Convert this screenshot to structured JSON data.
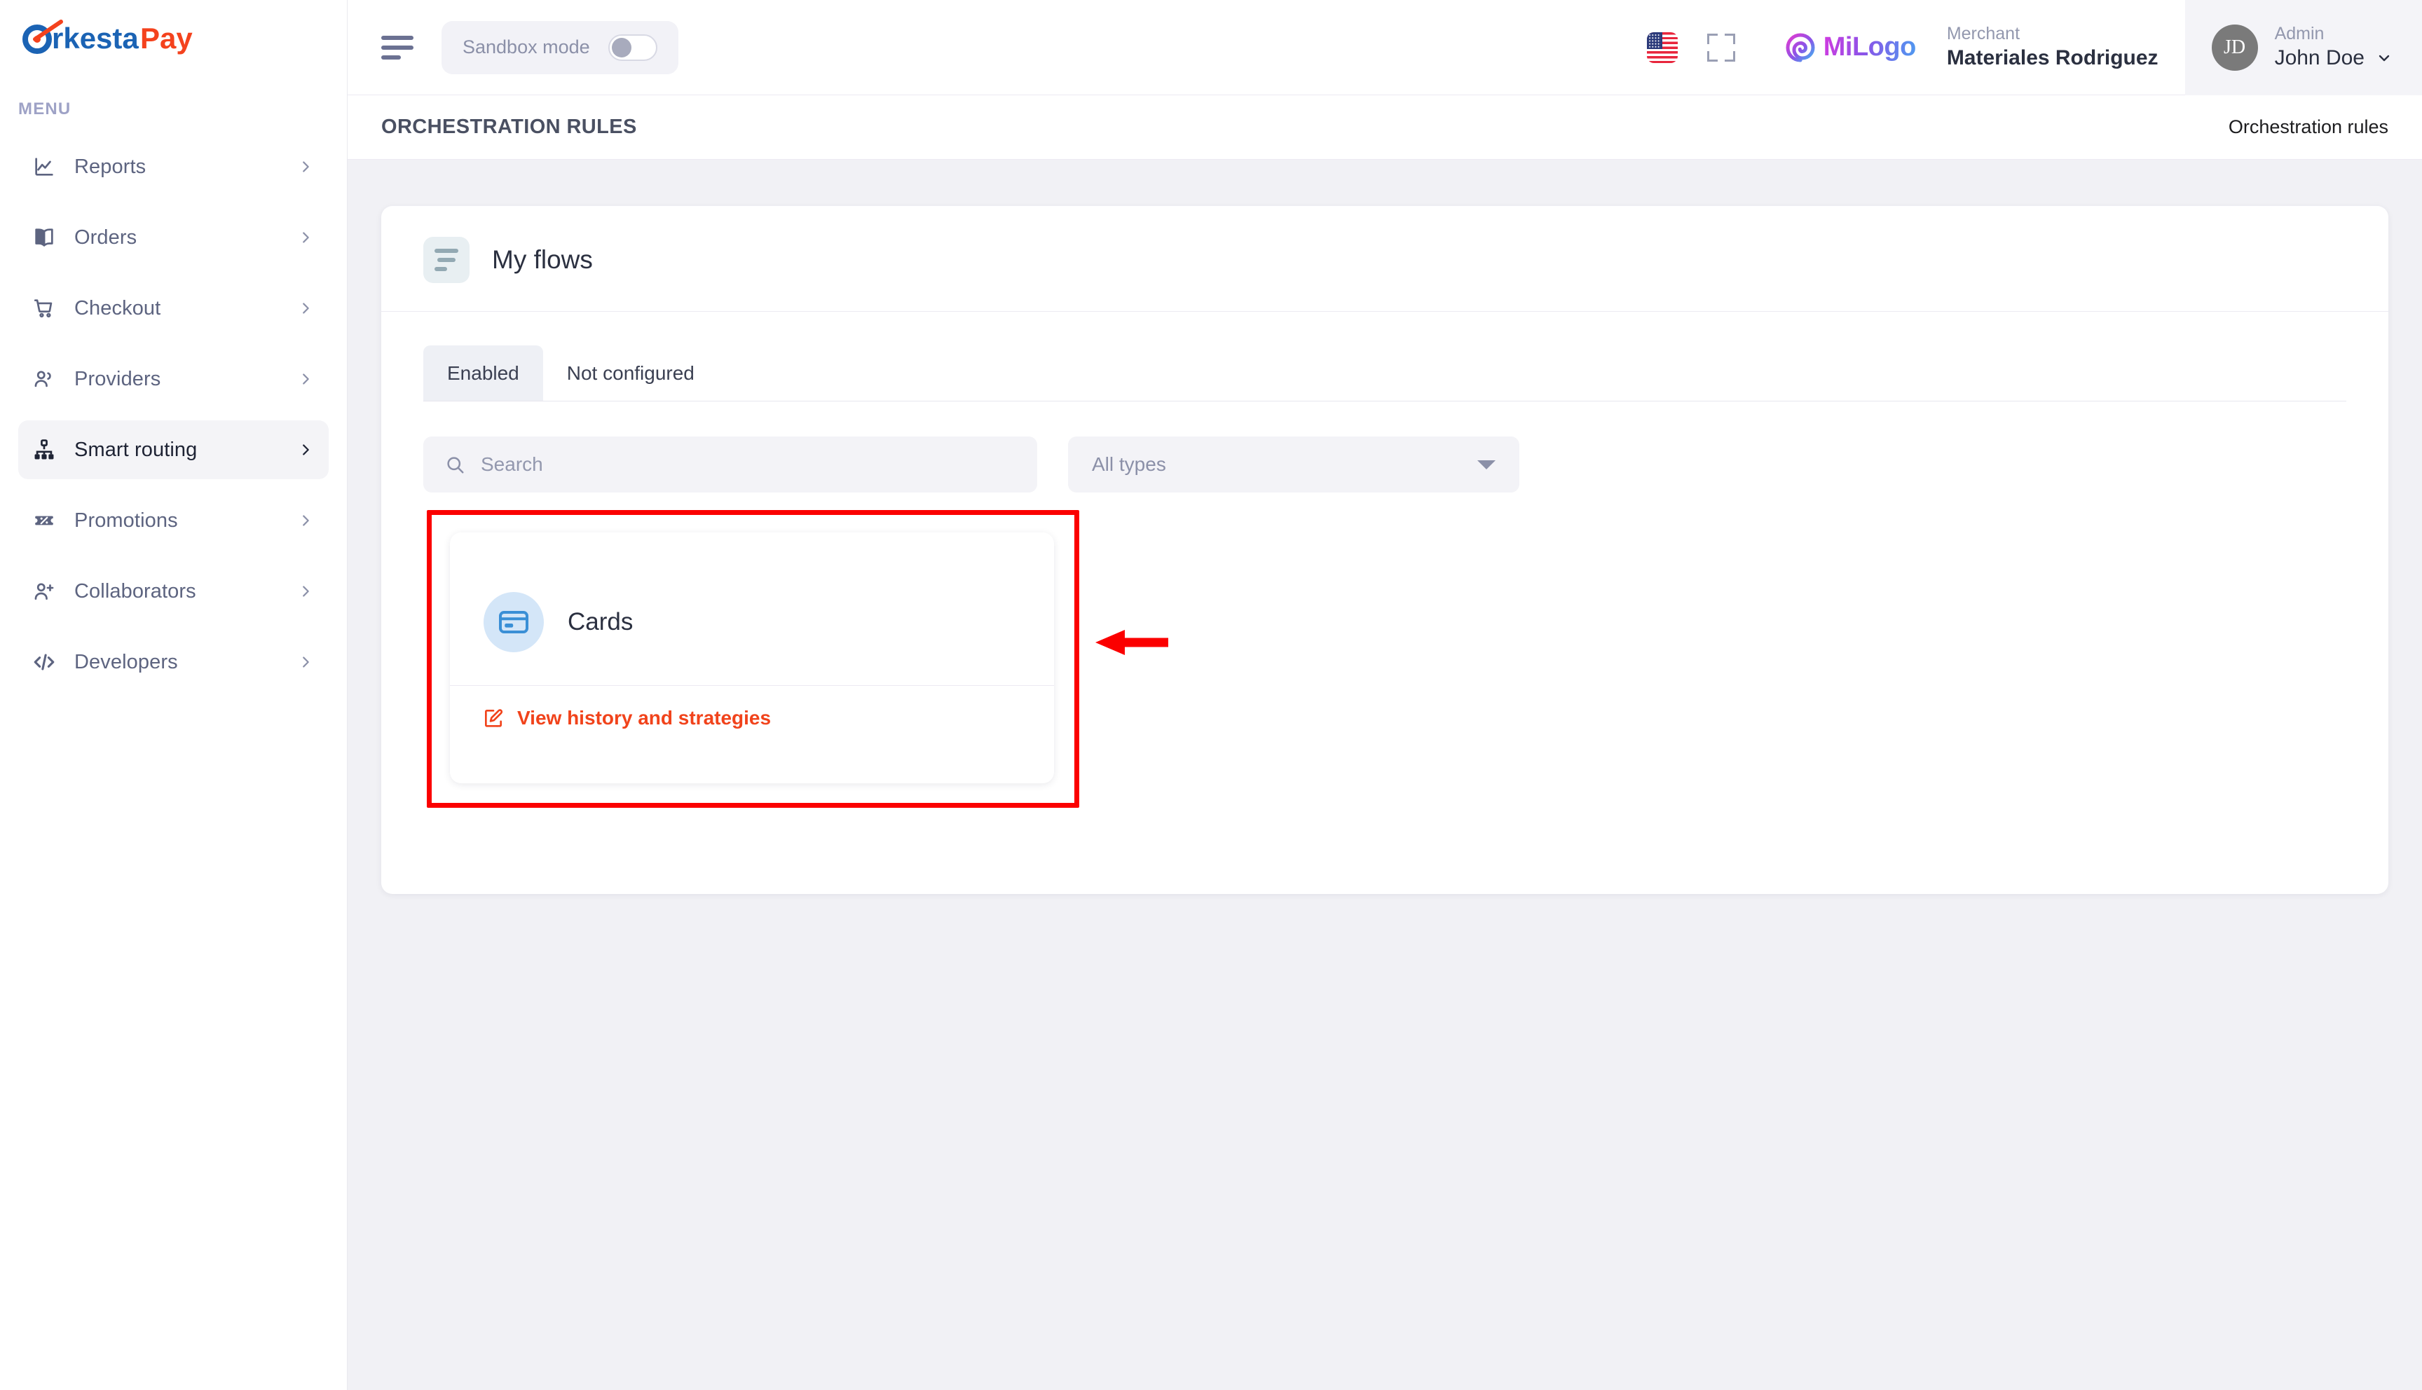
{
  "brand": {
    "logo_primary": "Orkesta",
    "logo_secondary": "Pay",
    "logo_primary_color": "#1b63b4",
    "logo_secondary_color": "#f4421d"
  },
  "sidebar": {
    "section_label": "MENU",
    "items": [
      {
        "label": "Reports",
        "icon": "chart-line-icon",
        "active": false,
        "chevron": "chevron-right-icon"
      },
      {
        "label": "Orders",
        "icon": "book-icon",
        "active": false,
        "chevron": "chevron-right-icon"
      },
      {
        "label": "Checkout",
        "icon": "shopping-cart-icon",
        "active": false,
        "chevron": "chevron-right-icon"
      },
      {
        "label": "Providers",
        "icon": "users-icon",
        "active": false,
        "chevron": "chevron-right-icon"
      },
      {
        "label": "Smart routing",
        "icon": "sitemap-icon",
        "active": true,
        "chevron": "chevron-right-icon"
      },
      {
        "label": "Promotions",
        "icon": "ticket-percent-icon",
        "active": false,
        "chevron": "chevron-right-icon"
      },
      {
        "label": "Collaborators",
        "icon": "user-plus-icon",
        "active": false,
        "chevron": "chevron-right-icon"
      },
      {
        "label": "Developers",
        "icon": "code-icon",
        "active": false,
        "chevron": "chevron-right-icon"
      }
    ]
  },
  "topbar": {
    "menu_icon": "hamburger-icon",
    "sandbox_label": "Sandbox mode",
    "sandbox_enabled": false,
    "language_icon": "us-flag-icon",
    "fullscreen_icon": "expand-icon",
    "tenant_logo_text": "MiLogo",
    "merchant_label": "Merchant",
    "merchant_name": "Materiales Rodriguez",
    "account": {
      "avatar_initials": "JD",
      "role": "Admin",
      "name": "John Doe",
      "chevron": "chevron-down-icon"
    }
  },
  "breadcrumb": {
    "title": "ORCHESTRATION RULES",
    "right": "Orchestration rules"
  },
  "panel": {
    "icon": "flows-list-icon",
    "title": "My flows",
    "tabs": [
      {
        "label": "Enabled",
        "active": true
      },
      {
        "label": "Not configured",
        "active": false
      }
    ],
    "search": {
      "icon": "search-icon",
      "placeholder": "Search",
      "value": ""
    },
    "type_filter": {
      "selected": "All types",
      "caret": "caret-down-icon"
    },
    "flows": [
      {
        "icon": "credit-card-icon",
        "name": "Cards",
        "link_icon": "edit-square-icon",
        "link_label": "View history and strategies",
        "link_color": "#f1431b",
        "highlighted": true
      }
    ]
  },
  "annotation": {
    "box_color": "#fb0000",
    "arrow_icon": "left-arrow-icon",
    "arrow_color": "#fb0000"
  }
}
